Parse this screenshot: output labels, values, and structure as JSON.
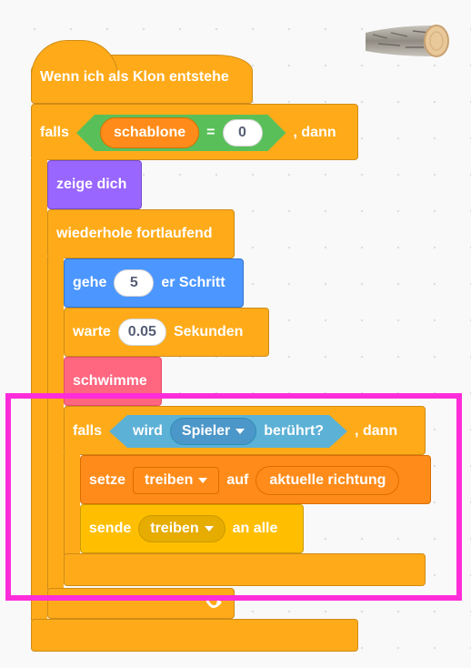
{
  "script": {
    "hat_label": "Wenn ich als Klon entstehe",
    "if1": {
      "falls": "falls",
      "dann": ", dann",
      "variable": "schablone",
      "equals": "=",
      "value": "0"
    },
    "show_label": "zeige dich",
    "forever_label": "wiederhole fortlaufend",
    "move": {
      "prefix": "gehe",
      "value": "5",
      "suffix": "er Schritt"
    },
    "wait": {
      "prefix": "warte",
      "value": "0.05",
      "suffix": "Sekunden"
    },
    "swim_label": "schwimme",
    "if2": {
      "falls": "falls",
      "dann": ", dann",
      "touching_prefix": "wird",
      "touching_target": "Spieler",
      "touching_suffix": "berührt?"
    },
    "set": {
      "prefix": "setze",
      "variable": "treiben",
      "mid": "auf",
      "value": "aktuelle richtung"
    },
    "broadcast": {
      "prefix": "sende",
      "message": "treiben",
      "suffix": "an alle"
    }
  },
  "colors": {
    "control": "#FFAB19",
    "looks": "#9966FF",
    "motion": "#4C97FF",
    "custom": "#FF6680",
    "variables": "#FF8C1A",
    "events": "#FFBF00",
    "operators": "#59C059",
    "sensing": "#5CB1D6",
    "highlight": "#FF2DD9"
  },
  "icons": {
    "loop_arrow": "loop-arrow-icon",
    "sprite": "log-sprite"
  }
}
